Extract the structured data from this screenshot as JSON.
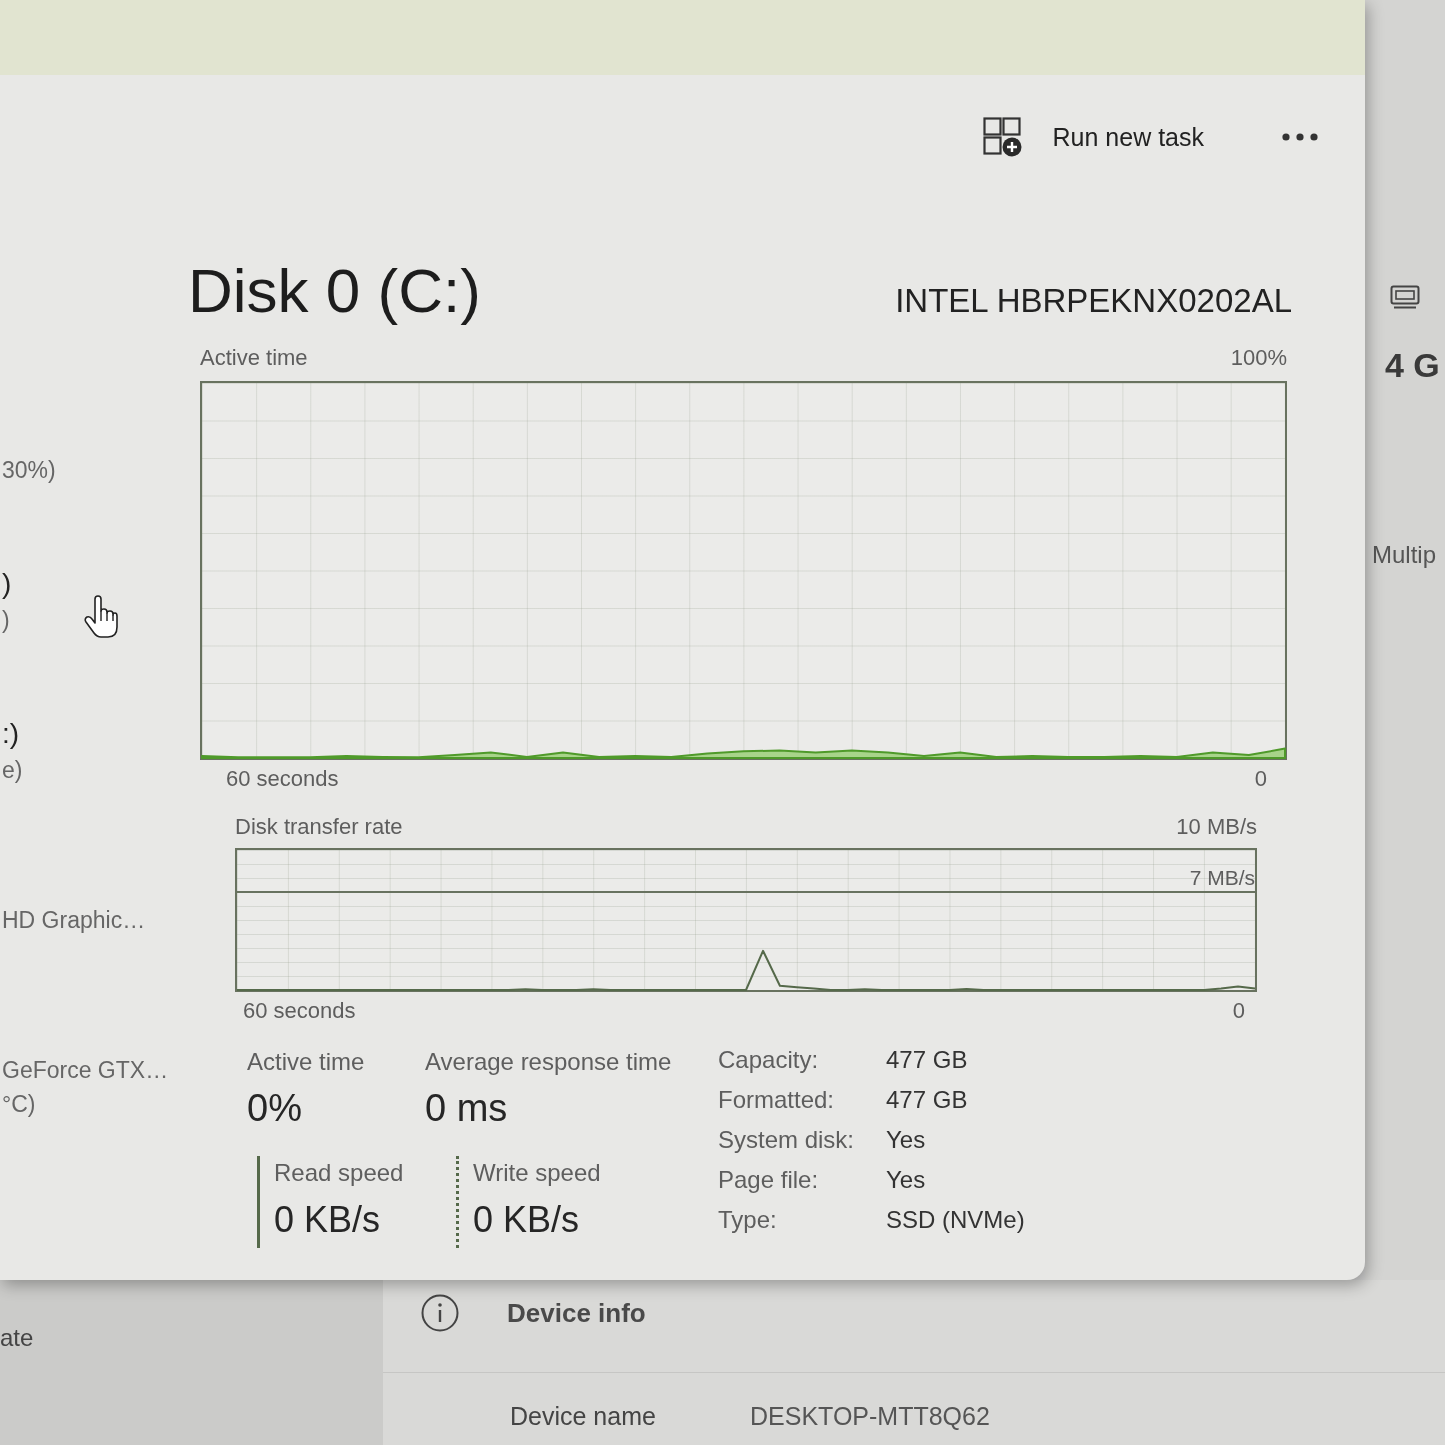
{
  "task_manager": {
    "toolbar": [
      {
        "kind": "run_task",
        "label": "Run new task"
      },
      {
        "kind": "more"
      }
    ],
    "sidebar": {
      "items": [
        {
          "lines": [
            {
              "kind": "detail",
              "text": "30%)"
            }
          ]
        },
        {
          "lines": [
            {
              "kind": "title",
              "text": ")"
            },
            {
              "kind": "detail",
              "text": ")"
            }
          ]
        },
        {
          "lines": [
            {
              "kind": "title",
              "text": ":)"
            },
            {
              "kind": "detail",
              "text": "e)"
            }
          ]
        },
        {
          "lines": [
            {
              "kind": "detail",
              "text": "HD Graphic…"
            }
          ]
        },
        {
          "lines": [
            {
              "kind": "detail",
              "text": "GeForce GTX…"
            },
            {
              "kind": "detail",
              "text": "°C)"
            }
          ]
        }
      ]
    },
    "disk": {
      "title": "Disk 0 (C:)",
      "model": "INTEL HBRPEKNX0202AL",
      "active_graph": {
        "title": "Active time",
        "scale_max": "100%",
        "time_span": "60 seconds",
        "time_end": "0"
      },
      "transfer_graph": {
        "title": "Disk transfer rate",
        "scale_max": "10 MB/s",
        "scale_line": "7 MB/s",
        "time_span": "60 seconds",
        "time_end": "0"
      },
      "stats": [
        {
          "label": "Active time",
          "value": "0%"
        },
        {
          "label": "Average response time",
          "value": "0 ms"
        }
      ],
      "speeds": [
        {
          "kind": "read",
          "label": "Read speed",
          "value": "0 KB/s"
        },
        {
          "kind": "write",
          "label": "Write speed",
          "value": "0 KB/s"
        }
      ],
      "properties": [
        {
          "label": "Capacity:",
          "value": "477 GB"
        },
        {
          "label": "Formatted:",
          "value": "477 GB"
        },
        {
          "label": "System disk:",
          "value": "Yes"
        },
        {
          "label": "Page file:",
          "value": "Yes"
        },
        {
          "label": "Type:",
          "value": "SSD (NVMe)"
        }
      ]
    }
  },
  "settings": {
    "side": {
      "value": "4 G",
      "caption": "Multip"
    },
    "nav": [
      {
        "label": "ate"
      }
    ],
    "device_info": {
      "title": "Device info",
      "rows": [
        {
          "label": "Device name",
          "value": "DESKTOP-MTT8Q62"
        }
      ]
    }
  }
}
